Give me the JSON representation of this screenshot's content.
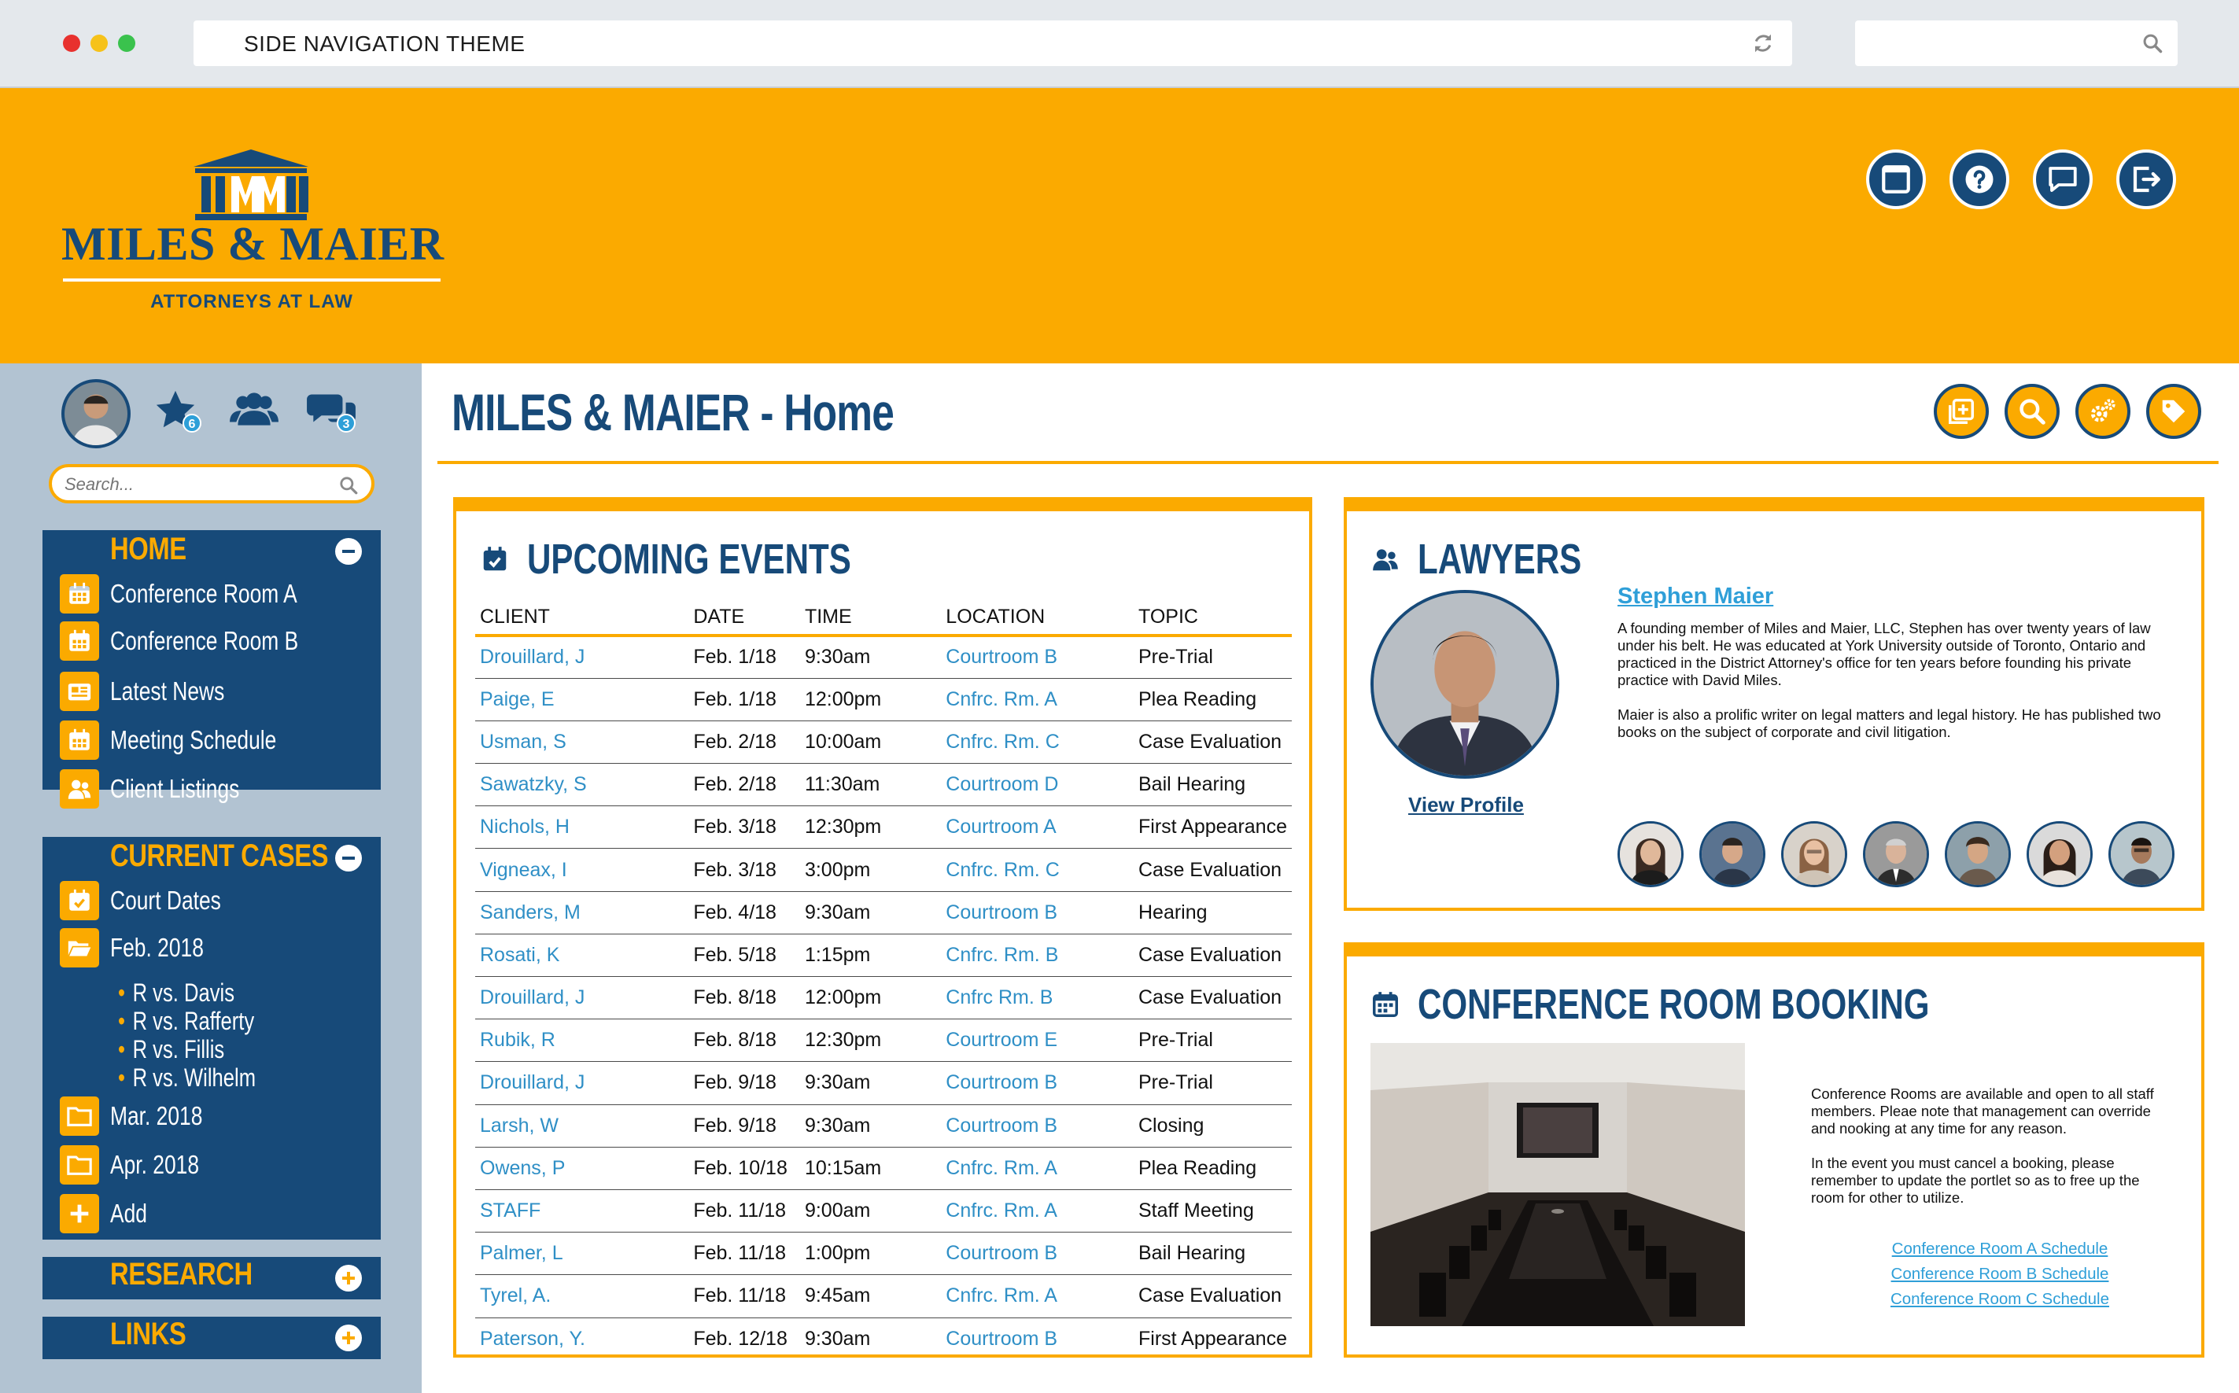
{
  "browser": {
    "url_text": "SIDE NAVIGATION THEME"
  },
  "logo": {
    "mark": "IIMMII",
    "name": "MILES & MAIER",
    "subtitle": "ATTORNEYS AT LAW"
  },
  "header_buttons": [
    "window-icon",
    "help-icon",
    "chat-icon",
    "logout-icon"
  ],
  "sidebar": {
    "favorites_count": "6",
    "messages_count": "3",
    "search_placeholder": "Search...",
    "home": {
      "title": "HOME",
      "items": [
        "Conference Room A",
        "Conference Room B",
        "Latest News",
        "Meeting Schedule",
        "Client Listings"
      ]
    },
    "current_cases": {
      "title": "CURRENT CASES",
      "court_dates": "Court Dates",
      "feb": "Feb. 2018",
      "feb_cases": [
        "R vs. Davis",
        "R vs. Rafferty",
        "R vs. Fillis",
        "R vs. Wilhelm"
      ],
      "mar": "Mar. 2018",
      "apr": "Apr. 2018",
      "add": "Add"
    },
    "research": {
      "title": "RESEARCH"
    },
    "links": {
      "title": "LINKS"
    }
  },
  "main": {
    "title": "MILES & MAIER - Home",
    "toolbar": [
      "add-icon",
      "search-icon",
      "settings-icon",
      "tag-icon"
    ]
  },
  "events": {
    "title": "UPCOMING EVENTS",
    "columns": [
      "CLIENT",
      "DATE",
      "TIME",
      "LOCATION",
      "TOPIC"
    ],
    "rows": [
      [
        "Drouillard, J",
        "Feb. 1/18",
        "9:30am",
        "Courtroom B",
        "Pre-Trial"
      ],
      [
        "Paige, E",
        "Feb. 1/18",
        "12:00pm",
        "Cnfrc. Rm. A",
        "Plea Reading"
      ],
      [
        "Usman, S",
        "Feb. 2/18",
        "10:00am",
        "Cnfrc. Rm. C",
        "Case Evaluation"
      ],
      [
        "Sawatzky, S",
        "Feb. 2/18",
        "11:30am",
        "Courtroom D",
        "Bail Hearing"
      ],
      [
        "Nichols, H",
        "Feb. 3/18",
        "12:30pm",
        "Courtroom A",
        "First Appearance"
      ],
      [
        "Vigneax, I",
        "Feb. 3/18",
        "3:00pm",
        "Cnfrc. Rm. C",
        "Case Evaluation"
      ],
      [
        "Sanders, M",
        "Feb. 4/18",
        "9:30am",
        "Courtroom B",
        "Hearing"
      ],
      [
        "Rosati, K",
        "Feb. 5/18",
        "1:15pm",
        "Cnfrc. Rm. B",
        "Case Evaluation"
      ],
      [
        "Drouillard, J",
        "Feb. 8/18",
        "12:00pm",
        "Cnfrc Rm. B",
        "Case Evaluation"
      ],
      [
        "Rubik, R",
        "Feb. 8/18",
        "12:30pm",
        "Courtroom E",
        "Pre-Trial"
      ],
      [
        "Drouillard, J",
        "Feb. 9/18",
        "9:30am",
        "Courtroom B",
        "Pre-Trial"
      ],
      [
        "Larsh, W",
        "Feb. 9/18",
        "9:30am",
        "Courtroom B",
        "Closing"
      ],
      [
        "Owens, P",
        "Feb. 10/18",
        "10:15am",
        "Cnfrc. Rm. A",
        "Plea Reading"
      ],
      [
        "STAFF",
        "Feb. 11/18",
        "9:00am",
        "Cnfrc. Rm. A",
        "Staff Meeting"
      ],
      [
        "Palmer, L",
        "Feb. 11/18",
        "1:00pm",
        "Courtroom B",
        "Bail Hearing"
      ],
      [
        "Tyrel, A.",
        "Feb. 11/18",
        "9:45am",
        "Cnfrc. Rm. A",
        "Case Evaluation"
      ],
      [
        "Paterson, Y.",
        "Feb. 12/18",
        "9:30am",
        "Courtroom B",
        "First Appearance"
      ]
    ]
  },
  "lawyers": {
    "title": "LAWYERS",
    "name": "Stephen Maier",
    "bio_1": "A founding member of Miles and Maier, LLC, Stephen has over twenty years of law under his belt. He was educated at York University outside of Toronto, Ontario and practiced in the District Attorney's office for ten years before founding his private practice with David Miles.",
    "bio_2": "Maier is also a prolific writer on legal matters and legal history. He has published two books on the subject of corporate and civil litigation.",
    "view_profile": "View Profile"
  },
  "conference": {
    "title": "CONFERENCE ROOM BOOKING",
    "text_1": "Conference Rooms are available and open to all staff members. Pleae note that management can override and nooking at any time for any reason.",
    "text_2": "In the event you must cancel a booking, please remember to update the portlet so as to free up the room for other to utilize.",
    "links": [
      "Conference Room A Schedule",
      "Conference Room B Schedule",
      "Conference Room C Schedule"
    ]
  },
  "colors": {
    "orange": "#fbaa00",
    "navy": "#174a79",
    "sidebar_bg": "#b2c3d2",
    "link": "#2f8fc6"
  }
}
